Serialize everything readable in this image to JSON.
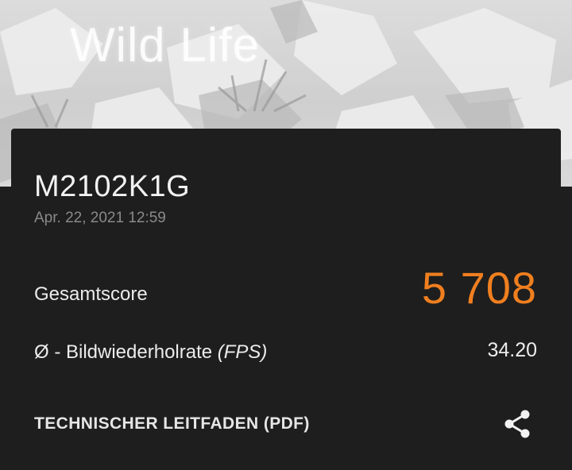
{
  "hero": {
    "title": "Wild Life"
  },
  "result": {
    "device": "M2102K1G",
    "date": "Apr. 22, 2021 12:59",
    "total_label": "Gesamtscore",
    "total_score": "5 708",
    "fps_label_prefix": "Ø - Bildwiederholrate ",
    "fps_label_unit": "(FPS)",
    "fps_value": "34.20",
    "guide_link": "TECHNISCHER LEITFADEN (PDF)"
  },
  "icons": {
    "share": "share-icon"
  },
  "colors": {
    "accent": "#f07f1f",
    "card_bg": "#1e1e1e",
    "secondary_text": "#8a8a8a"
  }
}
